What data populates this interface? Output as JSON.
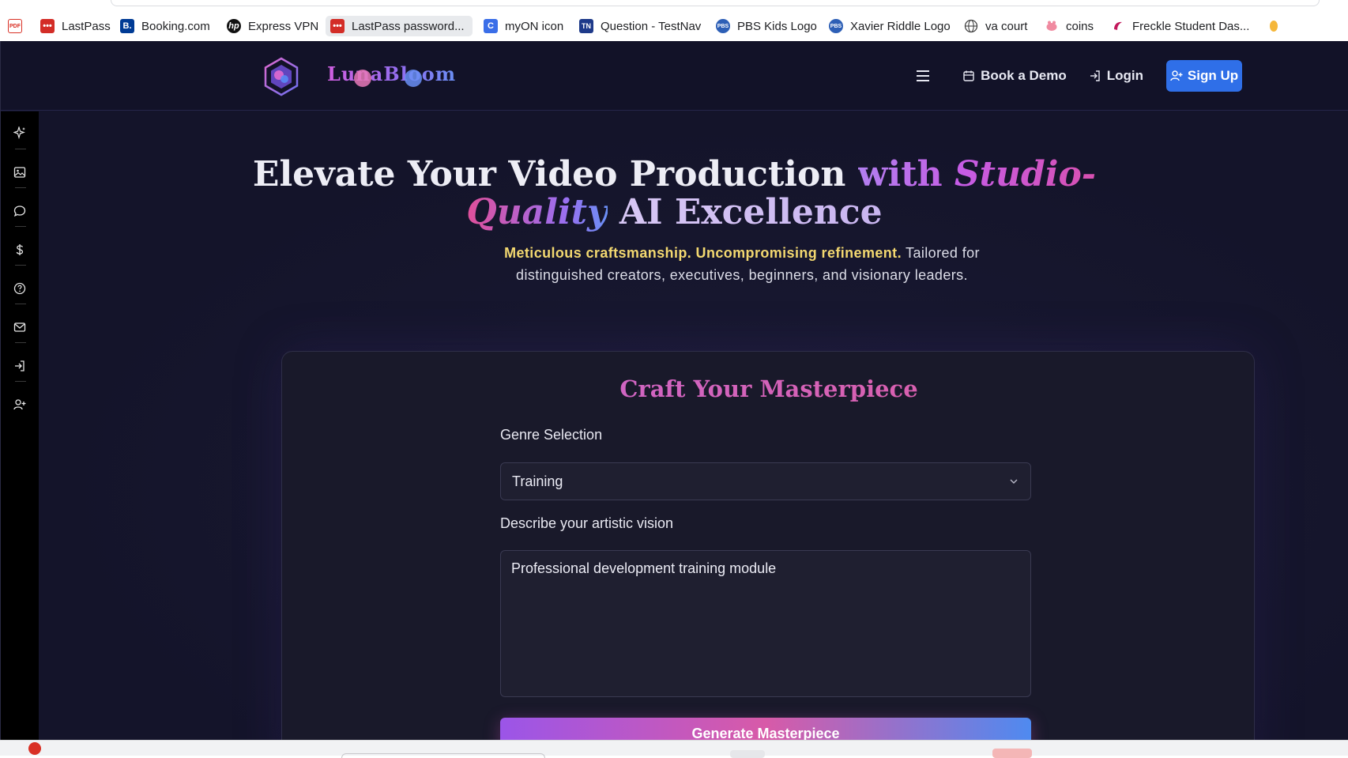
{
  "bookmarks": [
    {
      "label": "",
      "icon": "pdf-icon",
      "color": "#d93025"
    },
    {
      "label": "LastPass",
      "icon": "lastpass-icon",
      "color": "#d32d27"
    },
    {
      "label": "Booking.com",
      "icon": "booking-icon",
      "color": "#003b95"
    },
    {
      "label": "Express VPN",
      "icon": "hp-icon",
      "color": "#111111"
    },
    {
      "label": "LastPass password...",
      "icon": "lastpass-icon",
      "color": "#d32d27"
    },
    {
      "label": "myON icon",
      "icon": "myon-icon",
      "color": "#3a6ee8"
    },
    {
      "label": "Question - TestNav",
      "icon": "testnav-icon",
      "color": "#1e3a8a"
    },
    {
      "label": "PBS Kids Logo",
      "icon": "pbs-icon",
      "color": "#2d5fb6"
    },
    {
      "label": "Xavier Riddle Logo",
      "icon": "pbs-icon",
      "color": "#2d5fb6"
    },
    {
      "label": "va court",
      "icon": "globe-icon",
      "color": "#444444"
    },
    {
      "label": "coins",
      "icon": "piggy-icon",
      "color": "#e0607a"
    },
    {
      "label": "Freckle Student Das...",
      "icon": "freckle-icon",
      "color": "#c2185b"
    }
  ],
  "header": {
    "brand": "LunaBloom",
    "nav": {
      "book_demo": "Book a Demo",
      "login": "Login",
      "signup": "Sign Up"
    }
  },
  "hero": {
    "headline_part1": "Elevate Your Video Production ",
    "headline_with": "with ",
    "headline_studio": "Studio-",
    "headline_quality": "Quality",
    "headline_ai": " AI Excellence",
    "sub_highlight": "Meticulous craftsmanship. Uncompromising refinement.",
    "sub_rest": " Tailored for distinguished creators, executives, beginners, and visionary leaders."
  },
  "form": {
    "title": "Craft Your Masterpiece",
    "genre_label": "Genre Selection",
    "genre_value": "Training",
    "vision_label": "Describe your artistic vision",
    "vision_value": "Professional development training module",
    "generate_label": "Generate Masterpiece"
  },
  "sidebar_icons": [
    "sparkles-icon",
    "image-icon",
    "chat-icon",
    "dollar-icon",
    "help-icon",
    "mail-icon",
    "login-icon",
    "add-user-icon"
  ],
  "colors": {
    "background": "#14142a",
    "accent_blue": "#2f6fe8",
    "highlight_yellow": "#f3d870",
    "accent_pink": "#e05a9a"
  }
}
